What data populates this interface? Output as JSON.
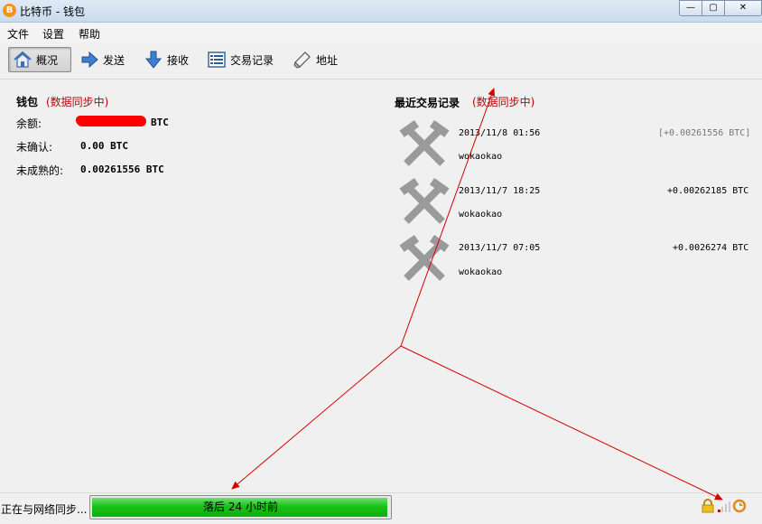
{
  "window": {
    "title": "比特币 - 钱包",
    "app_icon": "B",
    "buttons": {
      "minimize": "—",
      "maximize": "▢",
      "close": "✕"
    }
  },
  "menu": {
    "items": [
      "文件",
      "设置",
      "帮助"
    ]
  },
  "toolbar": {
    "overview": "概况",
    "send": "发送",
    "receive": "接收",
    "transactions": "交易记录",
    "address": "地址"
  },
  "wallet": {
    "title": "钱包",
    "sync_status": "(数据同步中)",
    "balance_label": "余额:",
    "balance_unit": "BTC",
    "unconfirmed_label": "未确认:",
    "unconfirmed_value": "0.00 BTC",
    "immature_label": "未成熟的:",
    "immature_value": "0.00261556 BTC"
  },
  "recent": {
    "title": "最近交易记录",
    "sync_status": "(数据同步中)",
    "transactions": [
      {
        "date": "2013/11/8 01:56",
        "amount": "[+0.00261556 BTC]",
        "label": "wokaokao",
        "amount_color": "#777777"
      },
      {
        "date": "2013/11/7 18:25",
        "amount": "+0.00262185 BTC",
        "label": "wokaokao",
        "amount_color": "#000000"
      },
      {
        "date": "2013/11/7 07:05",
        "amount": "+0.0026274 BTC",
        "label": "wokaokao",
        "amount_color": "#000000"
      }
    ]
  },
  "status": {
    "sync_text": "正在与网络同步...",
    "progress_text": "落后 24 小时前",
    "progress_fraction": 0.995
  },
  "colors": {
    "accent_red": "#c00000",
    "annotation_arrow": "#d40000",
    "progress_green": "#18c218"
  }
}
